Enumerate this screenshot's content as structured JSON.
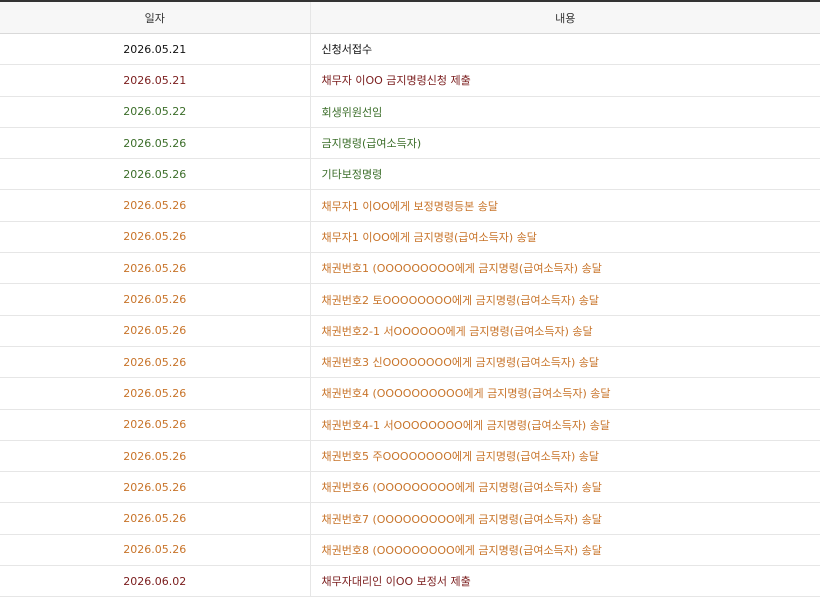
{
  "table": {
    "headers": {
      "date": "일자",
      "content": "내용"
    },
    "colors": {
      "black": "#111111",
      "maroon": "#7a1c1c",
      "green": "#3c6e2a",
      "orange": "#c8742a"
    },
    "rows": [
      {
        "date": "2026.05.21",
        "content": "신청서접수",
        "color": "black"
      },
      {
        "date": "2026.05.21",
        "content": "채무자 이OO 금지명령신청 제출",
        "color": "maroon"
      },
      {
        "date": "2026.05.22",
        "content": "회생위원선임",
        "color": "green"
      },
      {
        "date": "2026.05.26",
        "content": "금지명령(급여소득자)",
        "color": "green"
      },
      {
        "date": "2026.05.26",
        "content": "기타보정명령",
        "color": "green"
      },
      {
        "date": "2026.05.26",
        "content": "채무자1 이OO에게 보정명령등본 송달",
        "color": "orange"
      },
      {
        "date": "2026.05.26",
        "content": "채무자1 이OO에게 금지명령(급여소득자) 송달",
        "color": "orange"
      },
      {
        "date": "2026.05.26",
        "content": "채권번호1 (OOOOOOOOO에게 금지명령(급여소득자) 송달",
        "color": "orange"
      },
      {
        "date": "2026.05.26",
        "content": "채권번호2 토OOOOOOOO에게 금지명령(급여소득자) 송달",
        "color": "orange"
      },
      {
        "date": "2026.05.26",
        "content": "채권번호2-1 서OOOOOO에게 금지명령(급여소득자) 송달",
        "color": "orange"
      },
      {
        "date": "2026.05.26",
        "content": "채권번호3 신OOOOOOOO에게 금지명령(급여소득자) 송달",
        "color": "orange"
      },
      {
        "date": "2026.05.26",
        "content": "채권번호4 (OOOOOOOOOO에게 금지명령(급여소득자) 송달",
        "color": "orange"
      },
      {
        "date": "2026.05.26",
        "content": "채권번호4-1 서OOOOOOOO에게 금지명령(급여소득자) 송달",
        "color": "orange"
      },
      {
        "date": "2026.05.26",
        "content": "채권번호5 주OOOOOOOO에게 금지명령(급여소득자) 송달",
        "color": "orange"
      },
      {
        "date": "2026.05.26",
        "content": "채권번호6 (OOOOOOOOO에게 금지명령(급여소득자) 송달",
        "color": "orange"
      },
      {
        "date": "2026.05.26",
        "content": "채권번호7 (OOOOOOOOO에게 금지명령(급여소득자) 송달",
        "color": "orange"
      },
      {
        "date": "2026.05.26",
        "content": "채권번호8 (OOOOOOOOO에게 금지명령(급여소득자) 송달",
        "color": "orange"
      },
      {
        "date": "2026.06.02",
        "content": "채무자대리인 이OO 보정서 제출",
        "color": "maroon"
      }
    ]
  }
}
